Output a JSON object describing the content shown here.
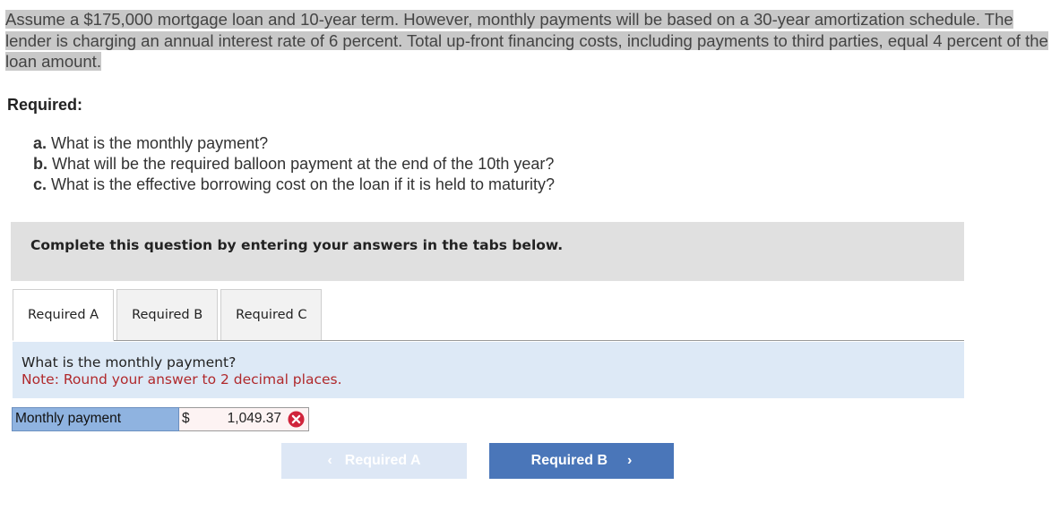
{
  "problem": {
    "text": "Assume a $175,000 mortgage loan and 10-year term. However, monthly payments will be based on a 30-year amortization schedule. The lender is charging an annual interest rate of 6 percent. Total up-front financing costs, including payments to third parties, equal 4 percent of the loan amount."
  },
  "required": {
    "heading": "Required:",
    "items": [
      {
        "letter": "a.",
        "text": "What is the monthly payment?"
      },
      {
        "letter": "b.",
        "text": "What will be the required balloon payment at the end of the 10th year?"
      },
      {
        "letter": "c.",
        "text": "What is the effective borrowing cost on the loan if it is held to maturity?"
      }
    ]
  },
  "instruction": "Complete this question by entering your answers in the tabs below.",
  "tabs": [
    {
      "label": "Required A",
      "active": true
    },
    {
      "label": "Required B",
      "active": false
    },
    {
      "label": "Required C",
      "active": false
    }
  ],
  "prompt": {
    "question": "What is the monthly payment?",
    "note": "Note: Round your answer to 2 decimal places."
  },
  "answer": {
    "label": "Monthly payment",
    "currency": "$",
    "value": "1,049.37",
    "status_icon": "x-icon",
    "status_color": "#d0243b"
  },
  "navigation": {
    "prev_label": "Required A",
    "next_label": "Required B",
    "prev_icon": "chevron-left-icon",
    "next_icon": "chevron-right-icon"
  }
}
